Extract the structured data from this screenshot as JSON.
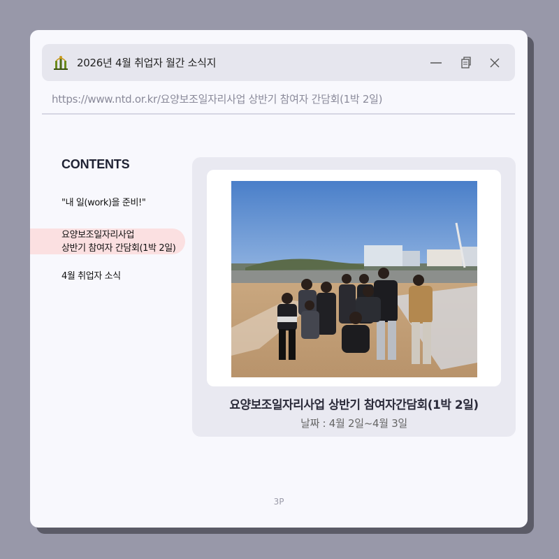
{
  "window": {
    "title": "2026년 4월 취업자 월간 소식지",
    "logo_icon": "ntd-logo-icon",
    "controls": [
      "minimize-icon",
      "restore-icon",
      "close-icon"
    ]
  },
  "address_bar": {
    "url": "https://www.ntd.or.kr/요양보조일자리사업 상반기 참여자 간담회(1박 2일)"
  },
  "sidebar": {
    "heading": "CONTENTS",
    "items": [
      {
        "label": "\"내 일(work)을 준비!\"",
        "active": false
      },
      {
        "label_line1": "요양보조일자리사업",
        "label_line2": "상반기 참여자 간담회(1박 2일)",
        "active": true
      },
      {
        "label": "4월 취업자 소식",
        "active": false
      }
    ]
  },
  "article": {
    "title": "요양보조일자리사업 상반기 참여자간담회(1박 2일)",
    "date": "날짜 : 4월 2일~4월 3일"
  },
  "footer": {
    "page": "3P"
  },
  "colors": {
    "background": "#9898a9",
    "window": "#f8f8fd",
    "active_item": "#fbe0e1",
    "panel": "#e9e9f1"
  }
}
